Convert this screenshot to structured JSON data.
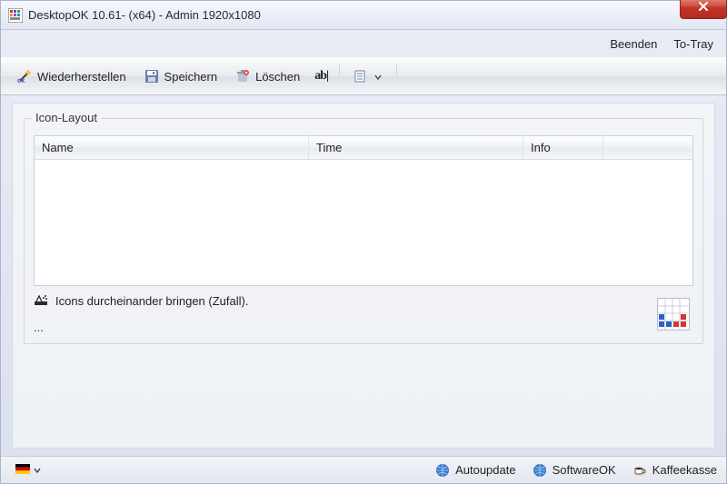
{
  "window": {
    "title": "DesktopOK 10.61- (x64) - Admin 1920x1080"
  },
  "menu": {
    "exit": "Beenden",
    "to_tray": "To-Tray"
  },
  "toolbar": {
    "restore": "Wiederherstellen",
    "save": "Speichern",
    "delete": "Löschen",
    "rename_tooltip": "ab|"
  },
  "group": {
    "title": "Icon-Layout"
  },
  "columns": {
    "name": "Name",
    "time": "Time",
    "info": "Info"
  },
  "actions": {
    "shuffle": "Icons durcheinander bringen (Zufall).",
    "more": "..."
  },
  "status": {
    "autoupdate": "Autoupdate",
    "softwareok": "SoftwareOK",
    "donate": "Kaffeekasse"
  },
  "icons": {
    "app": "desktopok-app-icon",
    "close": "close-icon",
    "restore": "wand-icon",
    "save": "floppy-icon",
    "delete": "trash-icon",
    "rename": "rename-icon",
    "view": "view-options-icon",
    "shuffle": "shuffle-icon",
    "grid": "grid-thumb-icon",
    "flag": "flag-de-icon",
    "globe": "globe-icon",
    "coffee": "coffee-icon"
  }
}
